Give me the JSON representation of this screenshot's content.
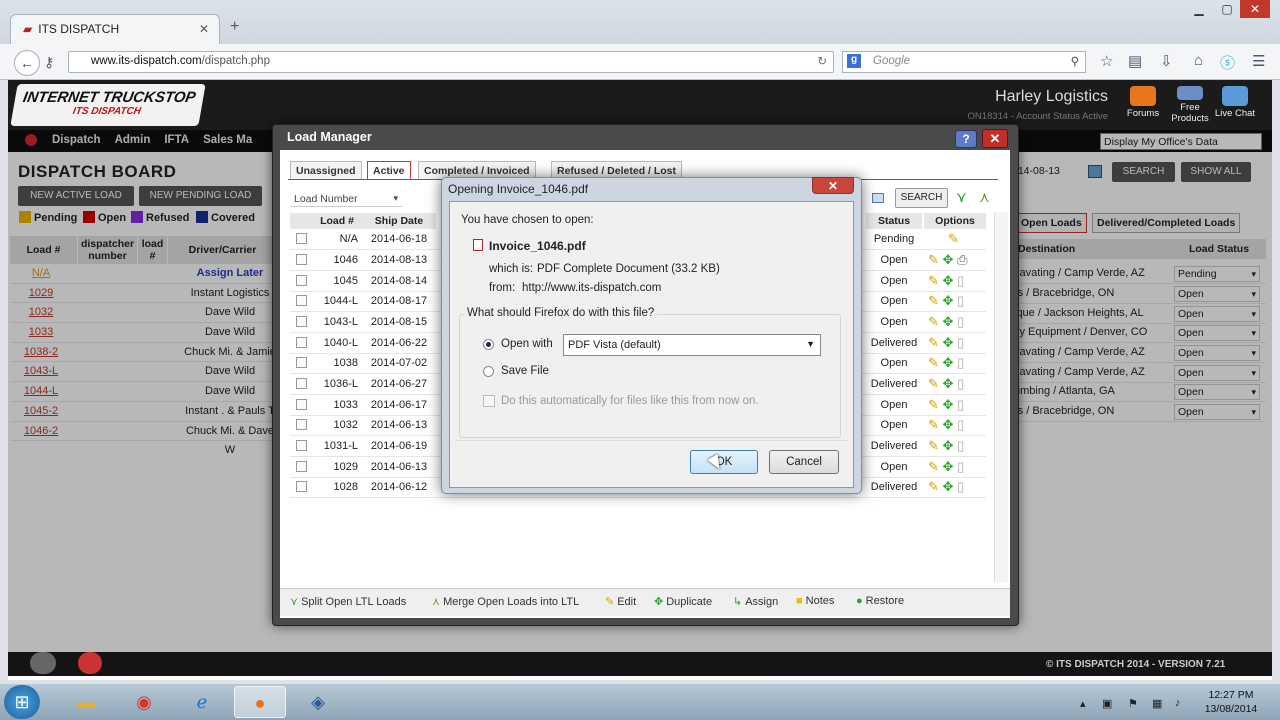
{
  "browser": {
    "tab_title": "ITS DISPATCH",
    "url_domain": "www.its-dispatch.com",
    "url_path": "/dispatch.php",
    "search_placeholder": "Google",
    "search_engine": "g"
  },
  "header": {
    "logo_line1": "INTERNET TRUCKSTOP",
    "logo_line2": "ITS DISPATCH",
    "company": "Harley Logistics",
    "account": "ON18314 - Account Status Active",
    "icons": [
      {
        "label": "Forums",
        "icon": "forums-icon",
        "color": "#e8761c"
      },
      {
        "label": "Free Products",
        "icon": "handshake-icon",
        "color": "#6b8fc4"
      },
      {
        "label": "Live Chat",
        "icon": "chat-icon",
        "color": "#5a9ad8"
      }
    ]
  },
  "menu": [
    "Dispatch",
    "Admin",
    "IFTA",
    "Sales Ma"
  ],
  "office_select": "Display My Office's Data",
  "board": {
    "title": "DISPATCH BOARD",
    "buttons": [
      "NEW ACTIVE LOAD",
      "NEW PENDING LOAD"
    ],
    "legend": [
      {
        "label": "Pending",
        "color": "#f0b400"
      },
      {
        "label": "Open",
        "color": "#d40000"
      },
      {
        "label": "Refused",
        "color": "#8a2be2"
      },
      {
        "label": "Covered",
        "color": "#1a2d9c"
      }
    ],
    "columns": [
      "Load #",
      "dispatcher number",
      "load #",
      "Driver/Carrier"
    ],
    "rows": [
      {
        "load": "N/A",
        "driver": "Assign Later"
      },
      {
        "load": "1029",
        "driver": "Instant Logistics"
      },
      {
        "load": "1032",
        "driver": "Dave Wild"
      },
      {
        "load": "1033",
        "driver": "Dave Wild"
      },
      {
        "load": "1038-2",
        "driver": "Chuck Mi. & Jamie"
      },
      {
        "load": "1043-L",
        "driver": "Dave Wild"
      },
      {
        "load": "1044-L",
        "driver": "Dave Wild"
      },
      {
        "load": "1045-2",
        "driver": "Instant . & Pauls T"
      },
      {
        "load": "1046-2",
        "driver": "Chuck Mi. & Dave W"
      }
    ]
  },
  "right_panel": {
    "date": "014-08-13",
    "search_btn": "SEARCH",
    "show_all_btn": "SHOW ALL",
    "tabs": [
      "Open Loads",
      "Delivered/Completed Loads"
    ],
    "columns": [
      "Destination",
      "Load Status"
    ],
    "rows": [
      {
        "dest": "cavating / Camp Verde, AZ",
        "status": "Pending"
      },
      {
        "dest": "rs / Bracebridge, ON",
        "status": "Open"
      },
      {
        "dest": "ique / Jackson Heights, AL",
        "status": "Open"
      },
      {
        "dest": "vy Equipment / Denver, CO",
        "status": "Open"
      },
      {
        "dest": "cavating / Camp Verde, AZ",
        "status": "Open"
      },
      {
        "dest": "cavating / Camp Verde, AZ",
        "status": "Open"
      },
      {
        "dest": "umbing / Atlanta, GA",
        "status": "Open"
      },
      {
        "dest": "rs / Bracebridge, ON",
        "status": "Open"
      }
    ]
  },
  "footer": {
    "version": "© ITS DISPATCH 2014 - VERSION 7.21"
  },
  "load_manager": {
    "title": "Load Manager",
    "help": "?",
    "close": "✕",
    "tabs": [
      "Unassigned",
      "Active",
      "Completed / Invoiced",
      "Refused / Deleted / Lost"
    ],
    "filter": "Load Number",
    "search": "SEARCH",
    "columns": [
      "Load #",
      "Ship Date",
      "Status",
      "Options"
    ],
    "rows": [
      {
        "load": "N/A",
        "date": "2014-06-18",
        "status": "Pending"
      },
      {
        "load": "1046",
        "date": "2014-08-13",
        "status": "Open"
      },
      {
        "load": "1045",
        "date": "2014-08-14",
        "status": "Open"
      },
      {
        "load": "1044-L",
        "date": "2014-08-17",
        "status": "Open"
      },
      {
        "load": "1043-L",
        "date": "2014-08-15",
        "status": "Open"
      },
      {
        "load": "1040-L",
        "date": "2014-06-22",
        "status": "Delivered"
      },
      {
        "load": "1038",
        "date": "2014-07-02",
        "status": "Open"
      },
      {
        "load": "1036-L",
        "date": "2014-06-27",
        "status": "Delivered"
      },
      {
        "load": "1033",
        "date": "2014-06-17",
        "status": "Open"
      },
      {
        "load": "1032",
        "date": "2014-06-13",
        "status": "Open"
      },
      {
        "load": "1031-L",
        "date": "2014-06-19",
        "status": "Delivered"
      },
      {
        "load": "1029",
        "date": "2014-06-13",
        "status": "Open"
      },
      {
        "load": "1028",
        "date": "2014-06-12",
        "status": "Delivered"
      }
    ],
    "tools": [
      {
        "label": "Split Open LTL Loads",
        "icon": "split-icon"
      },
      {
        "label": "Merge Open Loads into LTL",
        "icon": "merge-icon"
      },
      {
        "label": "Edit",
        "icon": "pencil-icon"
      },
      {
        "label": "Duplicate",
        "icon": "duplicate-icon"
      },
      {
        "label": "Assign",
        "icon": "assign-icon"
      },
      {
        "label": "Notes",
        "icon": "notes-icon"
      },
      {
        "label": "Restore",
        "icon": "restore-icon"
      }
    ]
  },
  "dialog": {
    "title": "Opening Invoice_1046.pdf",
    "chosen": "You have chosen to open:",
    "filename": "Invoice_1046.pdf",
    "which_is_label": "which is:",
    "which_is": "PDF Complete Document (33.2 KB)",
    "from_label": "from:",
    "from": "http://www.its-dispatch.com",
    "question": "What should Firefox do with this file?",
    "open_with": "Open with",
    "app": "PDF Vista (default)",
    "save_file": "Save File",
    "auto": "Do this automatically for files like this from now on.",
    "ok": "OK",
    "cancel": "Cancel"
  },
  "taskbar": {
    "time": "12:27 PM",
    "date": "13/08/2014"
  }
}
